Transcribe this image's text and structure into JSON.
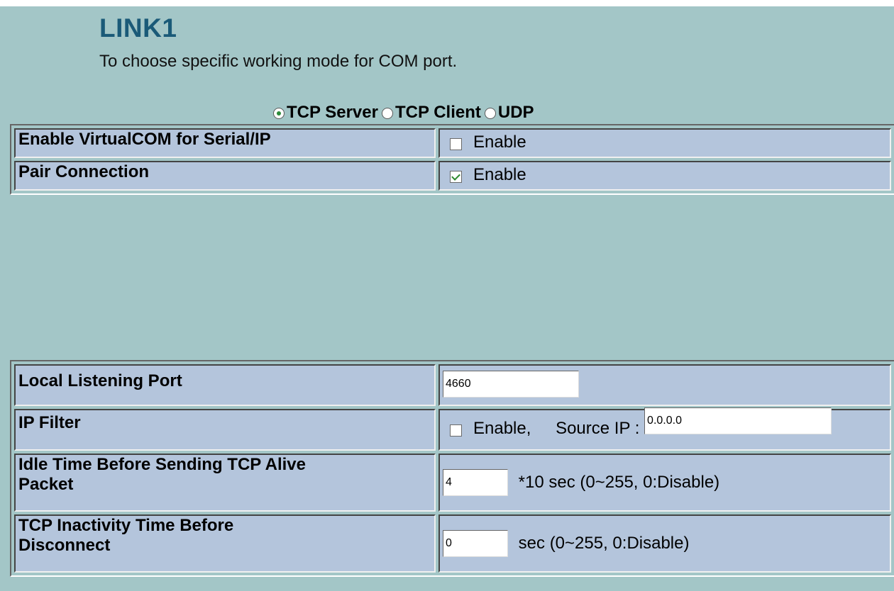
{
  "header": {
    "title": "LINK1",
    "subtitle": "To choose specific working mode for COM port."
  },
  "modes": {
    "options": [
      "TCP Server",
      "TCP Client",
      "UDP"
    ],
    "selected": "TCP Server"
  },
  "virtualcom": {
    "label": "Enable VirtualCOM for Serial/IP",
    "checkbox_label": "Enable",
    "checked": false
  },
  "pair": {
    "label": "Pair Connection",
    "checkbox_label": "Enable",
    "checked": true
  },
  "local_port": {
    "label": "Local Listening Port",
    "value": "4660"
  },
  "ip_filter": {
    "label": "IP Filter",
    "checkbox_label": "Enable,",
    "checked": false,
    "source_label": "Source IP :",
    "source_value": "0.0.0.0"
  },
  "idle_time": {
    "label_line1": "Idle Time Before Sending TCP Alive",
    "label_line2": "Packet",
    "value": "4",
    "unit": "*10 sec (0~255, 0:Disable)"
  },
  "inactivity": {
    "label_line1": "TCP Inactivity Time Before",
    "label_line2": "Disconnect",
    "value": "0",
    "unit": "sec (0~255, 0:Disable)"
  }
}
